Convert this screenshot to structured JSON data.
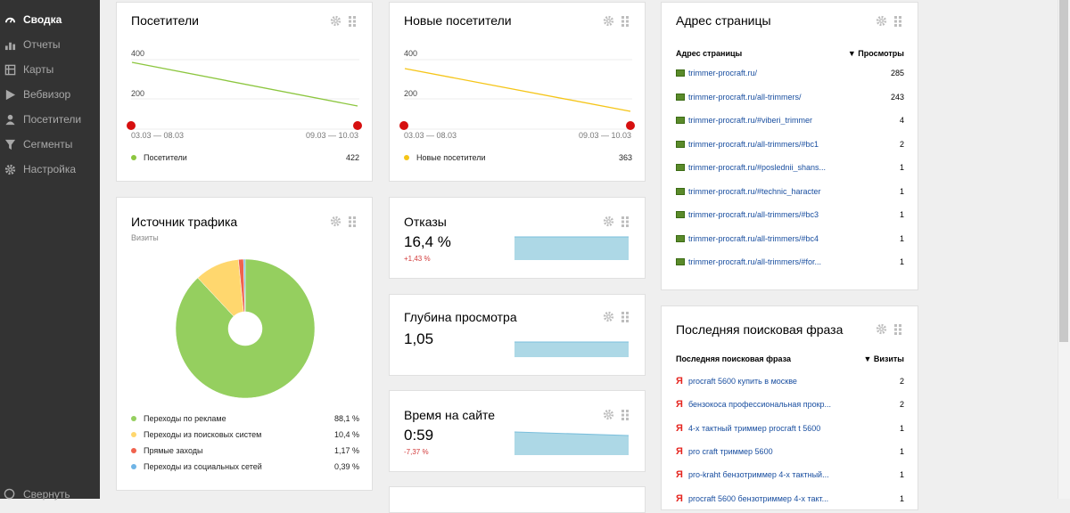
{
  "sidebar": {
    "items": [
      {
        "label": "Сводка",
        "icon": "dashboard-icon",
        "active": true
      },
      {
        "label": "Отчеты",
        "icon": "bar-chart-icon",
        "active": false
      },
      {
        "label": "Карты",
        "icon": "map-icon",
        "active": false
      },
      {
        "label": "Вебвизор",
        "icon": "play-icon",
        "active": false
      },
      {
        "label": "Посетители",
        "icon": "user-icon",
        "active": false
      },
      {
        "label": "Сегменты",
        "icon": "filter-icon",
        "active": false
      },
      {
        "label": "Настройка",
        "icon": "gear-icon",
        "active": false
      }
    ],
    "bottom_label": "Свернуть"
  },
  "visitors": {
    "title": "Посетители",
    "y_ticks": [
      "400",
      "200"
    ],
    "x_start": "03.03 — 08.03",
    "x_end": "09.03 — 10.03",
    "legend_label": "Посетители",
    "legend_value": "422",
    "color": "#8cc63f"
  },
  "new_visitors": {
    "title": "Новые посетители",
    "y_ticks": [
      "400",
      "200"
    ],
    "x_start": "03.03 — 08.03",
    "x_end": "09.03 — 10.03",
    "legend_label": "Новые посетители",
    "legend_value": "363",
    "color": "#f5c518"
  },
  "traffic": {
    "title": "Источник трафика",
    "subtitle": "Визиты",
    "items": [
      {
        "label": "Переходы по рекламе",
        "value": "88,1 %",
        "color": "#95cf5f"
      },
      {
        "label": "Переходы из поисковых систем",
        "value": "10,4 %",
        "color": "#ffd76e"
      },
      {
        "label": "Прямые заходы",
        "value": "1,17 %",
        "color": "#f0624d"
      },
      {
        "label": "Переходы из социальных сетей",
        "value": "0,39 %",
        "color": "#6fb4e6"
      }
    ]
  },
  "bounces": {
    "title": "Отказы",
    "value": "16,4 %",
    "delta": "+1,43 %"
  },
  "depth": {
    "title": "Глубина просмотра",
    "value": "1,05"
  },
  "time_on_site": {
    "title": "Время на сайте",
    "value": "0:59",
    "delta": "-7,37 %"
  },
  "pages": {
    "title": "Адрес страницы",
    "col_name": "Адрес страницы",
    "col_metric": "▼ Просмотры",
    "rows": [
      {
        "url": "trimmer-procraft.ru/",
        "value": "285"
      },
      {
        "url": "trimmer-procraft.ru/all-trimmers/",
        "value": "243"
      },
      {
        "url": "trimmer-procraft.ru/#viberi_trimmer",
        "value": "4"
      },
      {
        "url": "trimmer-procraft.ru/all-trimmers/#bc1",
        "value": "2"
      },
      {
        "url": "trimmer-procraft.ru/#poslednii_shans...",
        "value": "1"
      },
      {
        "url": "trimmer-procraft.ru/#technic_haracter",
        "value": "1"
      },
      {
        "url": "trimmer-procraft.ru/all-trimmers/#bc3",
        "value": "1"
      },
      {
        "url": "trimmer-procraft.ru/all-trimmers/#bc4",
        "value": "1"
      },
      {
        "url": "trimmer-procraft.ru/all-trimmers/#for...",
        "value": "1"
      }
    ]
  },
  "search": {
    "title": "Последняя поисковая фраза",
    "col_name": "Последняя поисковая фраза",
    "col_metric": "▼ Визиты",
    "rows": [
      {
        "phrase": "procraft 5600 купить в москве",
        "value": "2"
      },
      {
        "phrase": "бензокоса профессиональная прокр...",
        "value": "2"
      },
      {
        "phrase": "4-х тактный триммер procraft t 5600",
        "value": "1"
      },
      {
        "phrase": "pro craft триммер 5600",
        "value": "1"
      },
      {
        "phrase": "pro-kraht бензотриммер 4-х тактный...",
        "value": "1"
      },
      {
        "phrase": "procraft 5600 бензотриммер 4-х такт...",
        "value": "1"
      }
    ]
  }
}
